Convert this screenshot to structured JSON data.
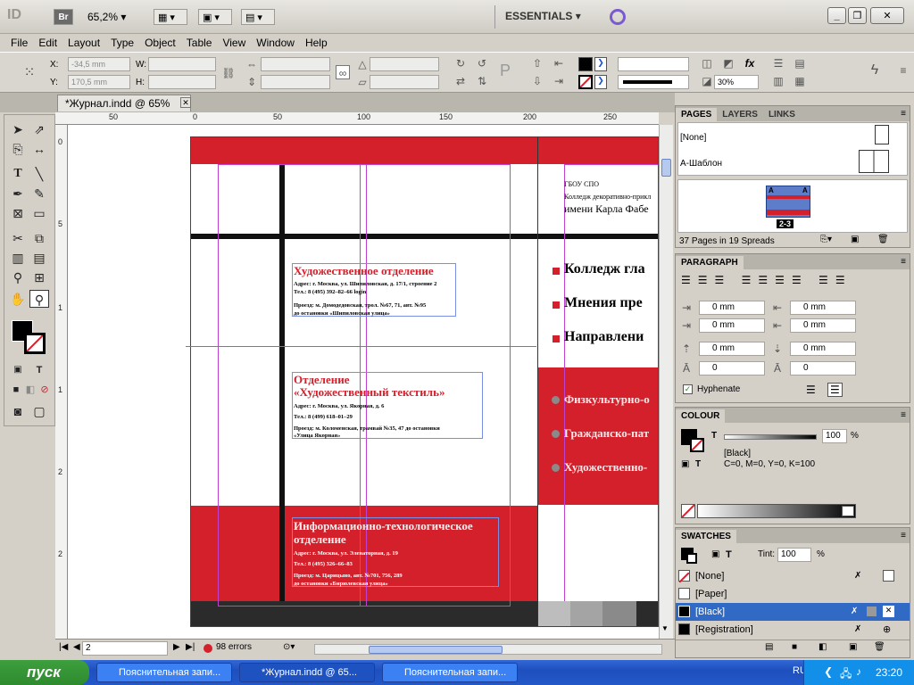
{
  "app": {
    "logo": "ID",
    "bridge": "Br",
    "zoom": "65,2%",
    "workspace": "ESSENTIALS"
  },
  "menu": [
    "File",
    "Edit",
    "Layout",
    "Type",
    "Object",
    "Table",
    "View",
    "Window",
    "Help"
  ],
  "control": {
    "x_label": "X:",
    "x_value": "-34,5 mm",
    "y_label": "Y:",
    "y_value": "170,5 mm",
    "w_label": "W:",
    "h_label": "H:",
    "opacity_value": "30%"
  },
  "document": {
    "tab_title": "*Журнал.indd @ 65%",
    "hruler_ticks": [
      "50",
      "0",
      "50",
      "100",
      "150",
      "200",
      "250"
    ],
    "vruler_ticks": [
      "0",
      "5",
      "1",
      "1",
      "2",
      "2"
    ],
    "vruler_ticks_second": [
      "0",
      "0",
      "5",
      "0",
      "5"
    ],
    "vruler_ticks_third": [
      "0",
      "0",
      "0"
    ]
  },
  "page": {
    "org_short": "ГБОУ СПО",
    "org_line2": "Колледж декоративно-прикл",
    "org_line3": "имени Карла Фабе",
    "dept1": {
      "title": "Художественное отделение",
      "address": "Адрес: г. Москва, ул. Шипиловская, д. 17/1, строение 2",
      "phone": "Тел.: 8 (495) 392–82–66 login",
      "route1": "Проезд: м. Домодедовская, трол. №67, 71, авт. №95",
      "route2": "до остановки «Шипиловская улица»"
    },
    "dept2": {
      "title1": "Отделение",
      "title2": "«Художественный текстиль»",
      "address": "Адрес: г. Москва, ул. Якорная, д. 6",
      "phone": "Тел.: 8 (499) 618–01–29",
      "route1": "Проезд: м. Коломенская, трамвай №35, 47 до остановки",
      "route2": "«Улица Якорная»"
    },
    "dept3": {
      "title1": "Информационно-технологическое",
      "title2": "отделение",
      "address": "Адрес: г. Москва, ул. Элеваторная, д. 19",
      "phone": "Тел.: 8 (495) 326–66–83",
      "route1": "Проезд: м. Царицыно, авт. №701, 756, 289",
      "route2": "до остановки «Бирюлевская улица»"
    },
    "bullets_right": [
      "Колледж гла",
      "Мнения пре",
      "Направлени"
    ],
    "bullets_red": [
      "Физкультурно-о",
      "Гражданско-пат",
      "Художественно-"
    ]
  },
  "status": {
    "page": "2",
    "errors": "98 errors"
  },
  "pages_panel": {
    "tabs": [
      "PAGES",
      "LAYERS",
      "LINKS"
    ],
    "none": "[None]",
    "master": "A-Шаблон",
    "spread_label": "2-3",
    "letter_a": "A",
    "letter_b": "A",
    "summary": "37 Pages in 19 Spreads"
  },
  "paragraph_panel": {
    "title": "PARAGRAPH",
    "indent1": "0 mm",
    "indent2": "0 mm",
    "indent3": "0 mm",
    "indent4": "0 mm",
    "space1": "0 mm",
    "space2": "0 mm",
    "drop1": "0",
    "drop2": "0",
    "hyphenate": "Hyphenate"
  },
  "colour_panel": {
    "title": "COLOUR",
    "tint": "100",
    "percent": "%",
    "name": "[Black]",
    "values": "C=0, M=0, Y=0, K=100"
  },
  "swatches_panel": {
    "title": "SWATCHES",
    "tint_label": "Tint:",
    "tint_value": "100",
    "percent": "%",
    "items": [
      "[None]",
      "[Paper]",
      "[Black]",
      "[Registration]"
    ]
  },
  "taskbar": {
    "start": "пуск",
    "tasks": [
      "Пояснительная запи...",
      "*Журнал.indd @ 65...",
      "Пояснительная запи..."
    ],
    "lang": "RU",
    "time": "23:20"
  },
  "colors": {
    "accent_red": "#d3202b",
    "selection_blue": "#316ac5"
  }
}
